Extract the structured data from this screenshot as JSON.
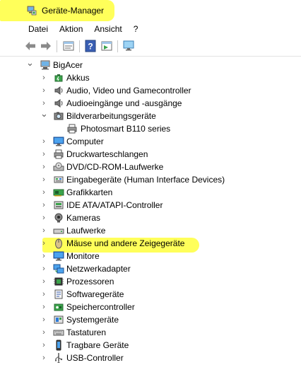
{
  "window": {
    "title": "Geräte-Manager",
    "title_icon": "device-manager-icon"
  },
  "menu": [
    "Datei",
    "Aktion",
    "Ansicht",
    "?"
  ],
  "toolbar": {
    "buttons": [
      "back-arrow-icon",
      "forward-arrow-icon",
      "properties-icon",
      "help-icon",
      "view-icon",
      "scan-hardware-icon"
    ]
  },
  "tree": {
    "root": {
      "label": "BigAcer",
      "icon": "computer-icon",
      "expanded": true
    },
    "children": [
      {
        "label": "Akkus",
        "icon": "battery-icon",
        "expanded": false
      },
      {
        "label": "Audio, Video und Gamecontroller",
        "icon": "speaker-icon",
        "expanded": false
      },
      {
        "label": "Audioeingänge und -ausgänge",
        "icon": "speaker-icon",
        "expanded": false
      },
      {
        "label": "Bildverarbeitungsgeräte",
        "icon": "camera-icon",
        "expanded": true,
        "children": [
          {
            "label": "Photosmart B110 series",
            "icon": "printer-icon"
          }
        ]
      },
      {
        "label": "Computer",
        "icon": "monitor-icon",
        "expanded": false
      },
      {
        "label": "Druckwarteschlangen",
        "icon": "printer-icon",
        "expanded": false
      },
      {
        "label": "DVD/CD-ROM-Laufwerke",
        "icon": "disc-drive-icon",
        "expanded": false
      },
      {
        "label": "Eingabegeräte (Human Interface Devices)",
        "icon": "hid-icon",
        "expanded": false
      },
      {
        "label": "Grafikkarten",
        "icon": "display-adapter-icon",
        "expanded": false
      },
      {
        "label": "IDE ATA/ATAPI-Controller",
        "icon": "ide-controller-icon",
        "expanded": false
      },
      {
        "label": "Kameras",
        "icon": "webcam-icon",
        "expanded": false
      },
      {
        "label": "Laufwerke",
        "icon": "drive-icon",
        "expanded": false
      },
      {
        "label": "Mäuse und andere Zeigegeräte",
        "icon": "mouse-icon",
        "expanded": false,
        "highlighted": true
      },
      {
        "label": "Monitore",
        "icon": "monitor-icon",
        "expanded": false
      },
      {
        "label": "Netzwerkadapter",
        "icon": "network-adapter-icon",
        "expanded": false
      },
      {
        "label": "Prozessoren",
        "icon": "processor-icon",
        "expanded": false
      },
      {
        "label": "Softwaregeräte",
        "icon": "software-device-icon",
        "expanded": false
      },
      {
        "label": "Speichercontroller",
        "icon": "storage-controller-icon",
        "expanded": false
      },
      {
        "label": "Systemgeräte",
        "icon": "system-device-icon",
        "expanded": false
      },
      {
        "label": "Tastaturen",
        "icon": "keyboard-icon",
        "expanded": false
      },
      {
        "label": "Tragbare Geräte",
        "icon": "portable-device-icon",
        "expanded": false
      },
      {
        "label": "USB-Controller",
        "icon": "usb-icon",
        "expanded": false
      }
    ]
  },
  "colors": {
    "highlight": "#ffff5a",
    "accent": "#2b7ad8"
  }
}
